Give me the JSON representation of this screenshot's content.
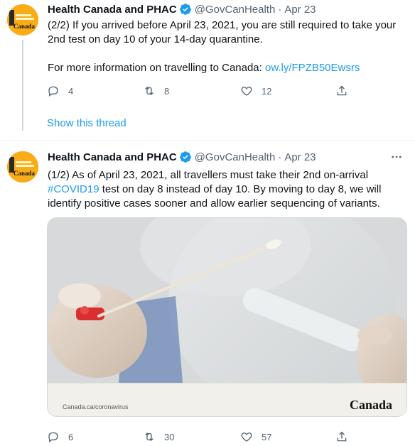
{
  "tweets": [
    {
      "author": {
        "name": "Health Canada and PHAC",
        "handle": "@GovCanHealth",
        "verified": true,
        "avatar_text": "Canada"
      },
      "date": "Apr 23",
      "separator": "·",
      "body": {
        "line1": "(2/2) If you arrived before April 23, 2021, you are still required to take your 2nd test on day 10 of your 14-day quarantine.",
        "line2_prefix": "For more information on travelling to Canada: ",
        "link": "ow.ly/FPZB50Ewsrs"
      },
      "actions": {
        "replies": "4",
        "retweets": "8",
        "likes": "12"
      }
    },
    {
      "author": {
        "name": "Health Canada and PHAC",
        "handle": "@GovCanHealth",
        "verified": true,
        "avatar_text": "Canada"
      },
      "date": "Apr 23",
      "separator": "·",
      "body": {
        "part1": "(1/2) As of April 23, 2021, all travellers must take their 2nd on-arrival ",
        "hashtag": "#COVID19",
        "part2": " test on day 8 instead of day 10. By moving to day 8, we will identify positive cases sooner and allow earlier sequencing of variants."
      },
      "card": {
        "source": "Canada.ca/coronavirus",
        "brand": "Canada"
      },
      "actions": {
        "replies": "6",
        "retweets": "30",
        "likes": "57"
      }
    }
  ],
  "show_thread_label": "Show this thread",
  "colors": {
    "accent": "#1d9bf0",
    "secondary_text": "#536471",
    "avatar_bg": "#f9ac16"
  }
}
